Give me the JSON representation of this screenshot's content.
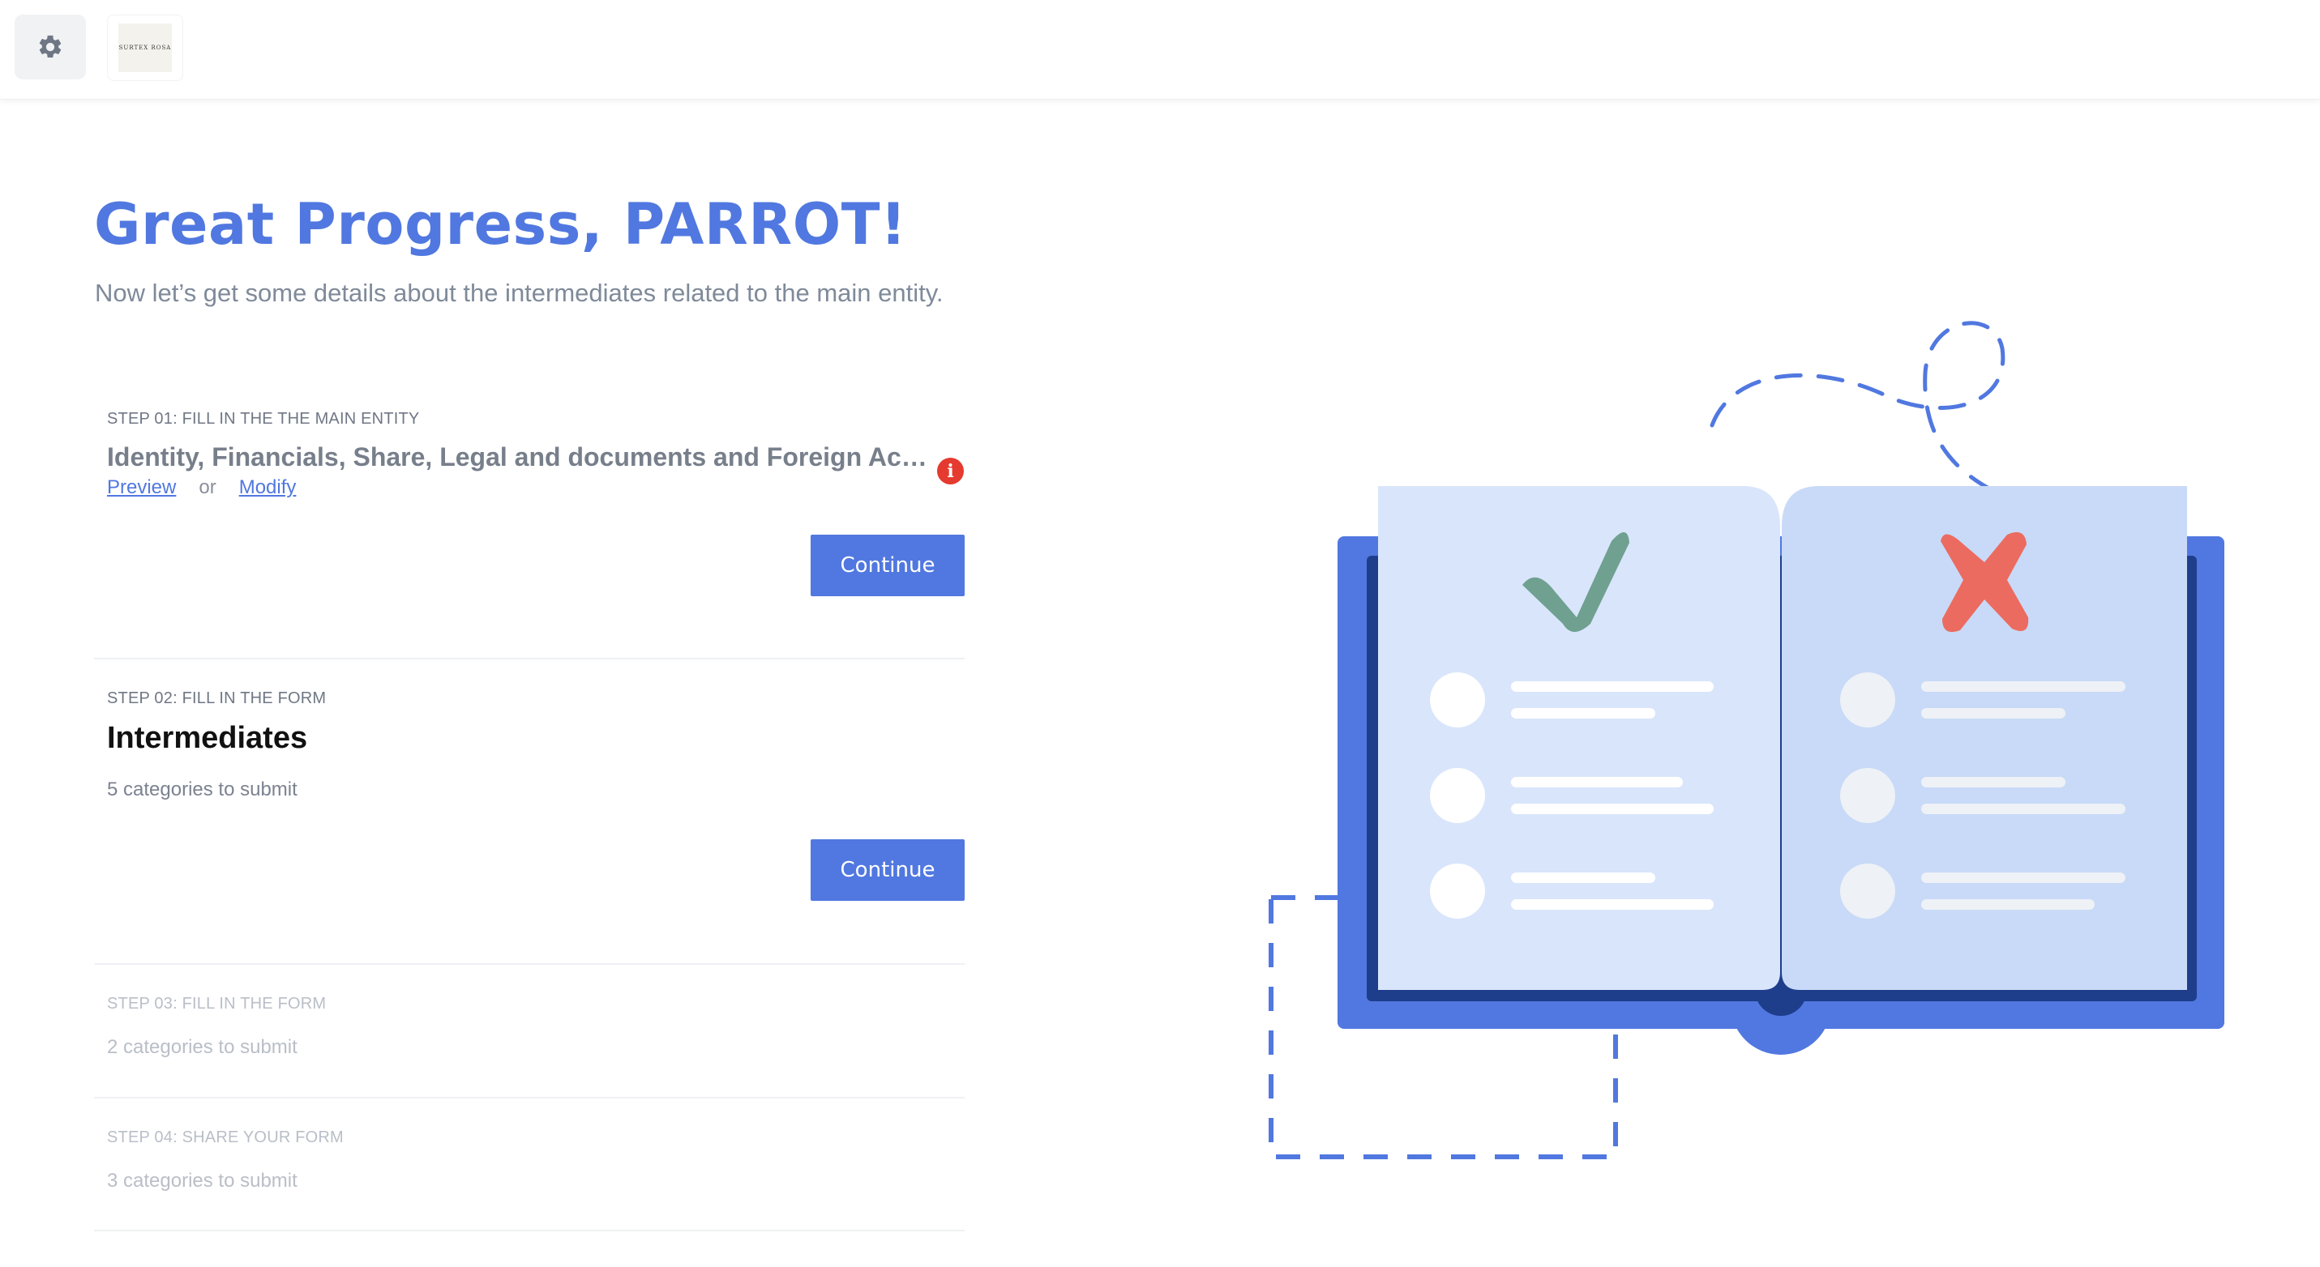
{
  "topbar": {
    "settings_icon": "gear-icon",
    "logo_text": "SURTEX ROSA"
  },
  "header": {
    "title": "Great Progress, PARROT!",
    "subtitle": "Now let’s get some details about the intermediates related to the main entity."
  },
  "steps": [
    {
      "label": "STEP 01: FILL IN THE THE MAIN ENTITY",
      "description": "Identity, Financials, Share, Legal and documents and Foreign Account...",
      "preview_link": "Preview",
      "or_text": "or",
      "modify_link": "Modify",
      "alert_icon": "info-icon",
      "button_label": "Continue"
    },
    {
      "label": "STEP 02: FILL IN THE FORM",
      "title": "Intermediates",
      "description": "5 categories to submit",
      "button_label": "Continue"
    },
    {
      "label": "STEP 03: FILL IN THE FORM",
      "description": "2 categories to submit"
    },
    {
      "label": "STEP 04: SHARE YOUR FORM",
      "description": "3 categories to submit"
    }
  ],
  "illustration": {
    "left_page_icon": "checkmark-icon",
    "right_page_icon": "x-mark-icon"
  },
  "colors": {
    "accent": "#5178e0",
    "alert": "#e53a2f",
    "check": "#6fa090",
    "cross": "#ec6b60"
  }
}
